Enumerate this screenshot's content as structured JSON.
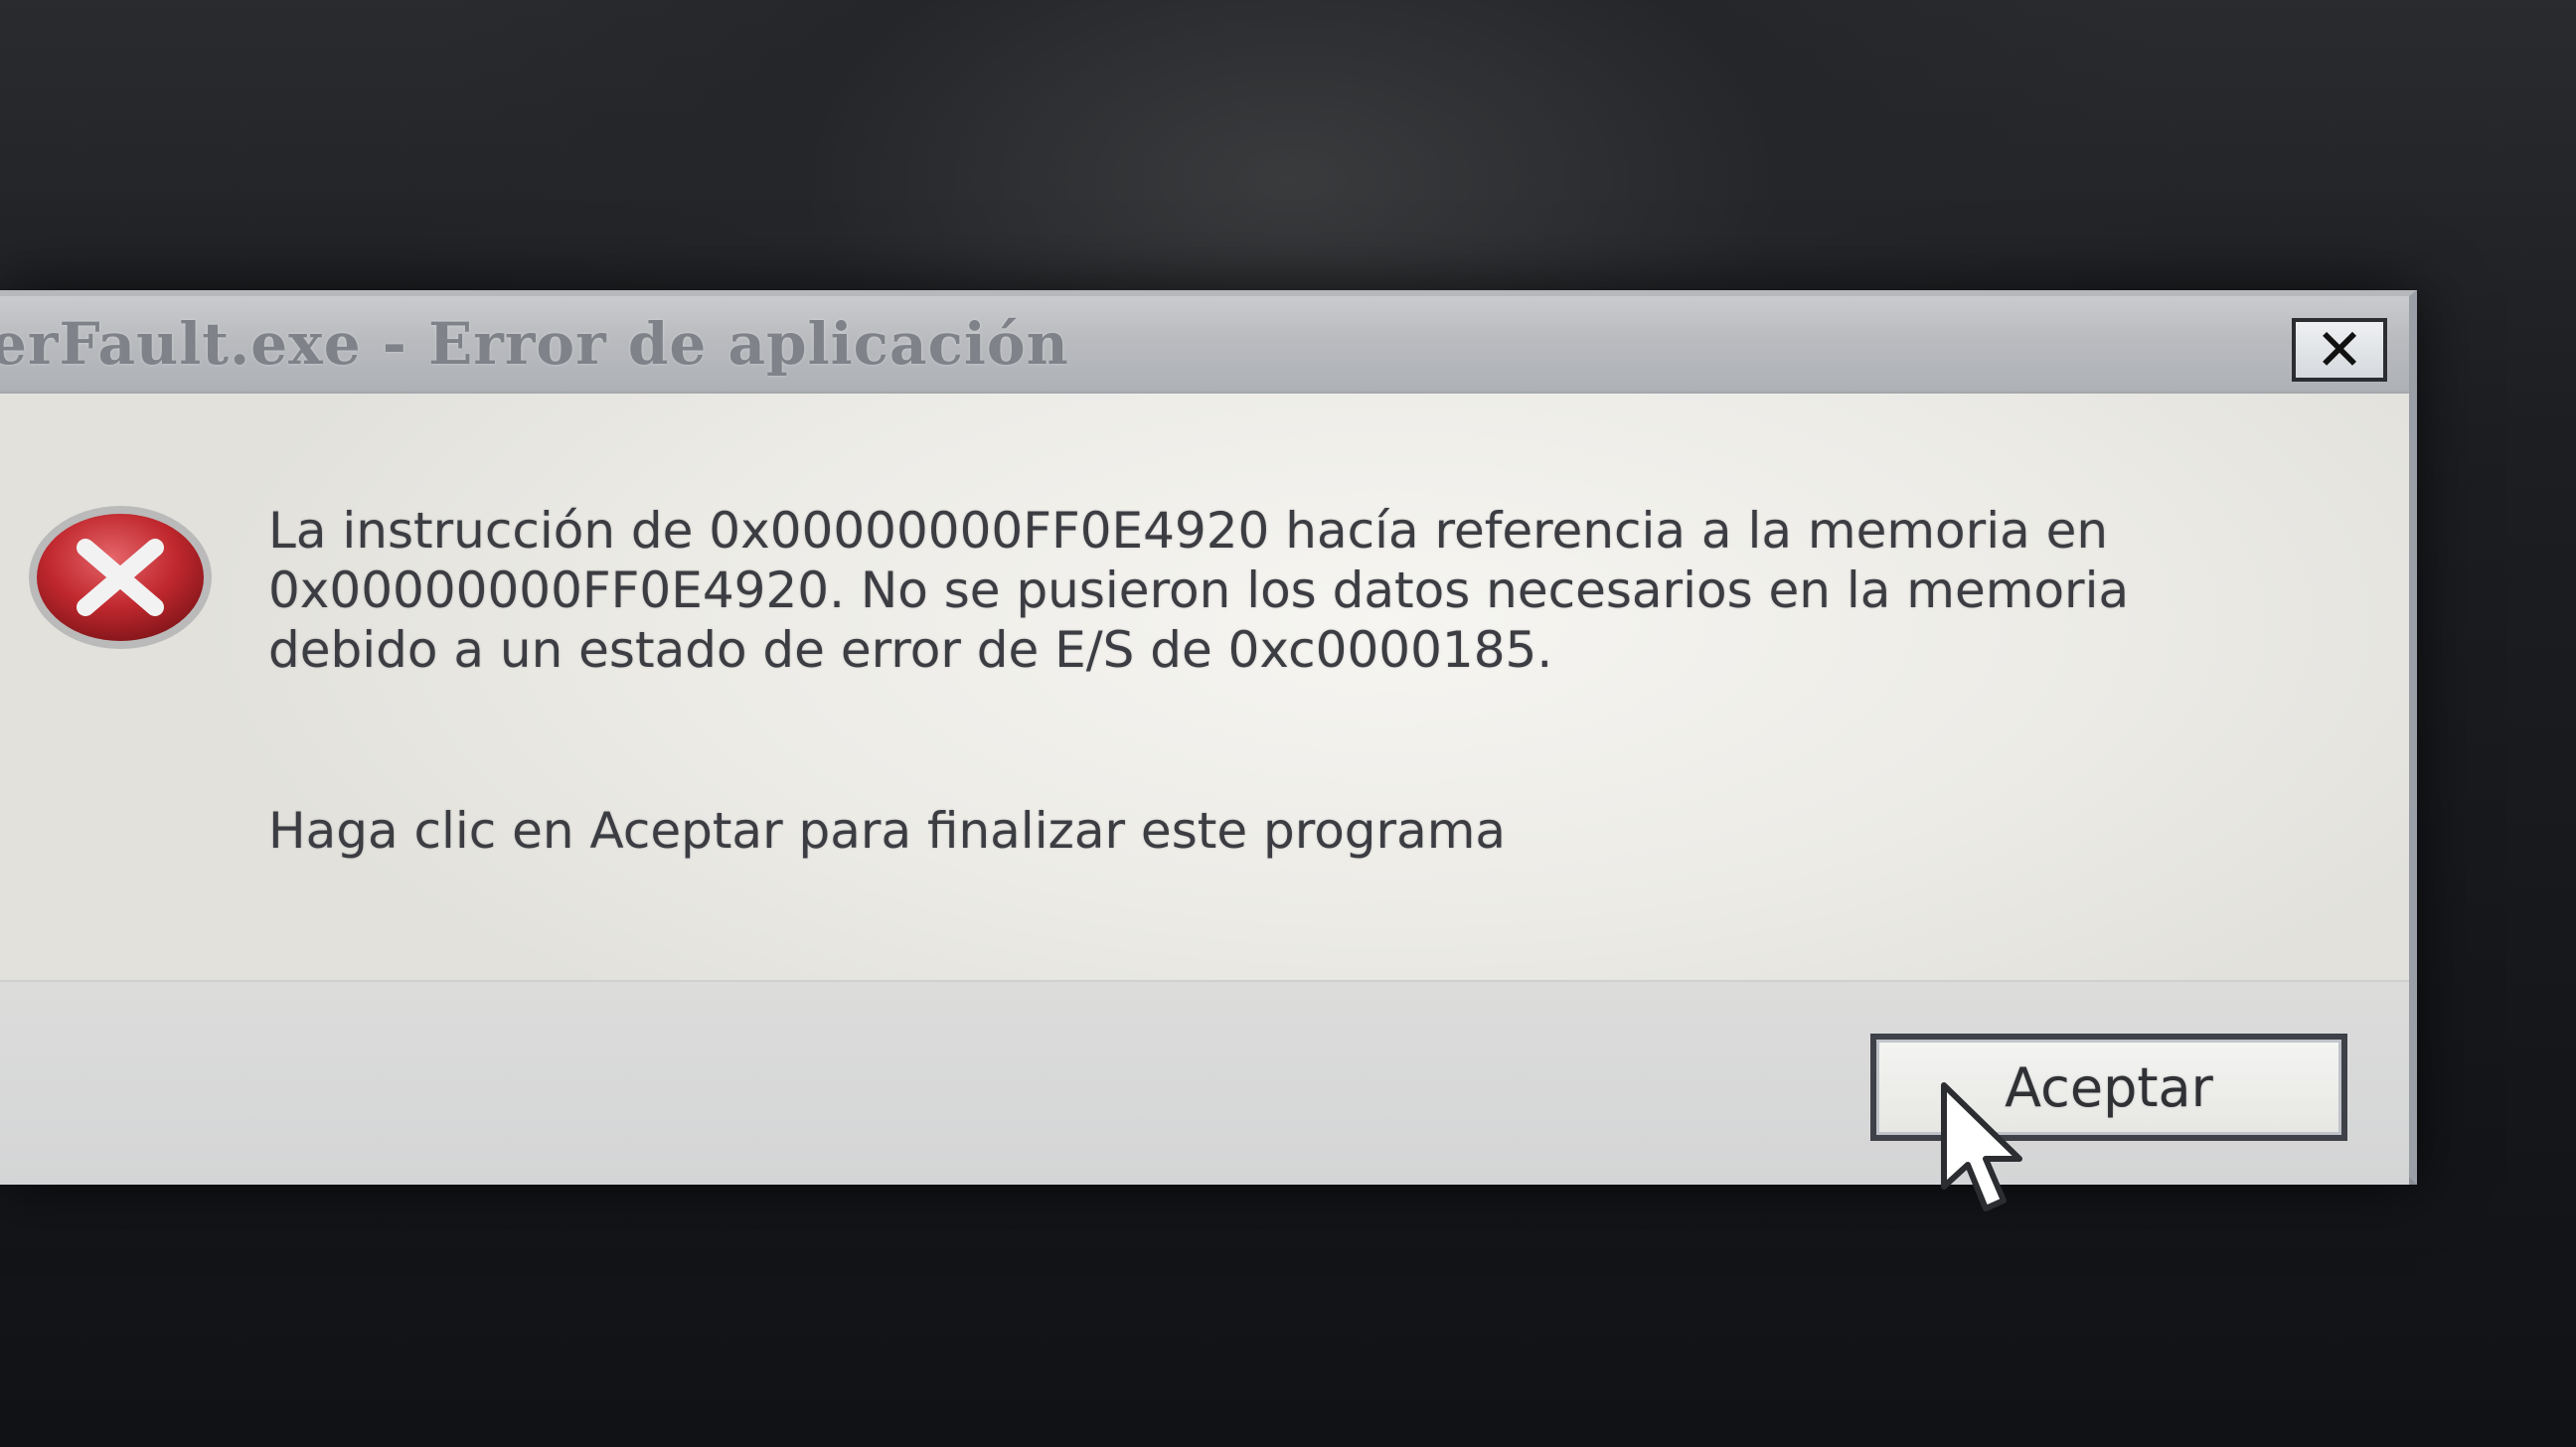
{
  "dialog": {
    "title": "erFault.exe - Error de aplicación",
    "close_label": "✕",
    "message": "La instrucción de 0x00000000FF0E4920 hacía referencia a la memoria en 0x00000000FF0E4920. No se pusieron los datos necesarios en la memoria debido a un estado de error de E/S de 0xc0000185.",
    "prompt": "Haga clic en Aceptar para finalizar este programa",
    "ok_label": "Aceptar",
    "icon": "error-icon"
  },
  "colors": {
    "error_red": "#c0282e",
    "dialog_background": "#f1f0ec",
    "title_bar": "#b9bbbf",
    "footer": "#d6d7d7"
  }
}
